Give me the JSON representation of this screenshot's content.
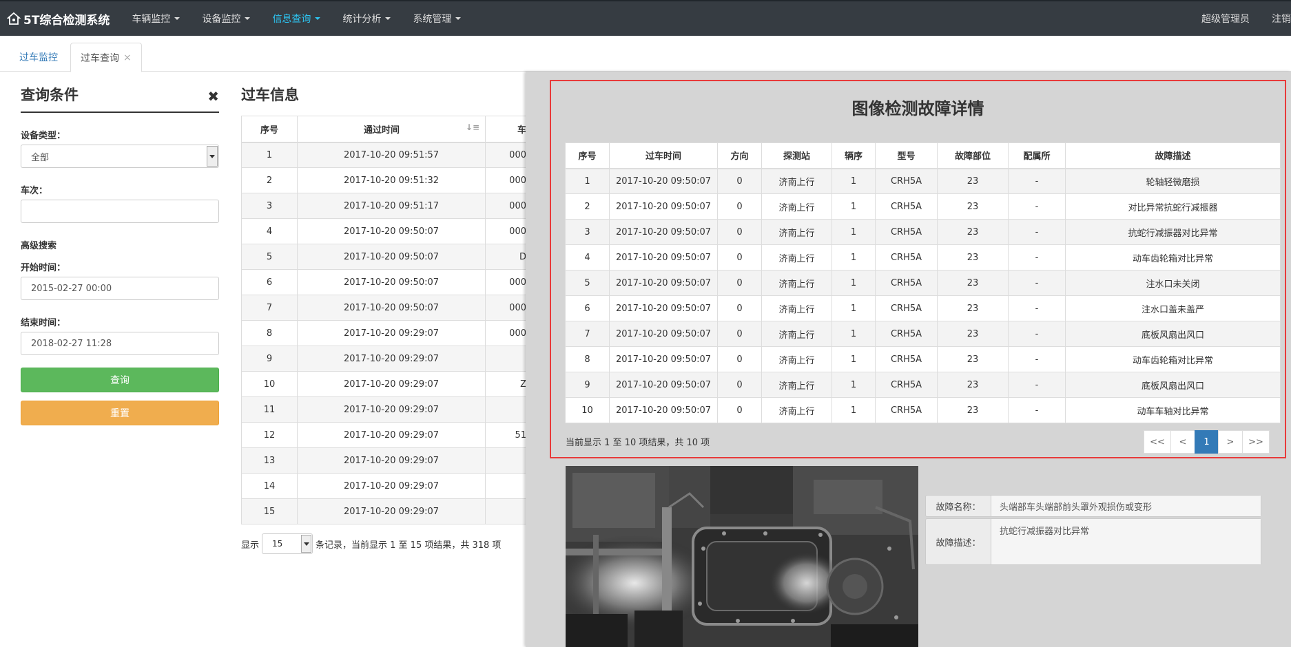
{
  "navbar": {
    "brand": "5T综合检测系统",
    "items": [
      "车辆监控",
      "设备监控",
      "信息查询",
      "统计分析",
      "系统管理"
    ],
    "active_index": 2,
    "user": "超级管理员",
    "logout": "注销",
    "colors": {
      "background": "#363c42",
      "active": "#2dc3f0"
    }
  },
  "tabs": [
    {
      "label": "过车监控"
    },
    {
      "label": "过车查询",
      "close": "×"
    }
  ],
  "query": {
    "title": "查询条件",
    "close": "✖",
    "device_type_label": "设备类型：",
    "device_type_value": "全部",
    "train_no_label": "车次：",
    "train_no_value": "",
    "advanced_label": "高级搜索",
    "start_label": "开始时间：",
    "start_value": "2015-02-27 00:00",
    "end_label": "结束时间：",
    "end_value": "2018-02-27 11:28",
    "search_button": "查询",
    "reset_button": "重置"
  },
  "passing": {
    "title": "过车信息",
    "headers": [
      "序号",
      "通过时间",
      "车"
    ],
    "rows": [
      [
        "1",
        "2017-10-20 09:51:57",
        "000"
      ],
      [
        "2",
        "2017-10-20 09:51:32",
        "000"
      ],
      [
        "3",
        "2017-10-20 09:51:17",
        "000"
      ],
      [
        "4",
        "2017-10-20 09:50:07",
        "000"
      ],
      [
        "5",
        "2017-10-20 09:50:07",
        "D"
      ],
      [
        "6",
        "2017-10-20 09:50:07",
        "000"
      ],
      [
        "7",
        "2017-10-20 09:50:07",
        "000"
      ],
      [
        "8",
        "2017-10-20 09:29:07",
        "000"
      ],
      [
        "9",
        "2017-10-20 09:29:07",
        ""
      ],
      [
        "10",
        "2017-10-20 09:29:07",
        "Z"
      ],
      [
        "11",
        "2017-10-20 09:29:07",
        ""
      ],
      [
        "12",
        "2017-10-20 09:29:07",
        "51"
      ],
      [
        "13",
        "2017-10-20 09:29:07",
        ""
      ],
      [
        "14",
        "2017-10-20 09:29:07",
        ""
      ],
      [
        "15",
        "2017-10-20 09:29:07",
        ""
      ]
    ],
    "footer_show": "显示",
    "page_size": "15",
    "footer_text": "条记录，当前显示 1 至 15 项结果，共 318 项"
  },
  "detail": {
    "title": "图像检测故障详情",
    "headers": [
      "序号",
      "过车时间",
      "方向",
      "探测站",
      "辆序",
      "型号",
      "故障部位",
      "配属所",
      "故障描述"
    ],
    "rows": [
      [
        "1",
        "2017-10-20 09:50:07",
        "0",
        "济南上行",
        "1",
        "CRH5A",
        "23",
        "-",
        "轮轴轻微磨损"
      ],
      [
        "2",
        "2017-10-20 09:50:07",
        "0",
        "济南上行",
        "1",
        "CRH5A",
        "23",
        "-",
        "对比异常抗蛇行减振器"
      ],
      [
        "3",
        "2017-10-20 09:50:07",
        "0",
        "济南上行",
        "1",
        "CRH5A",
        "23",
        "-",
        "抗蛇行减振器对比异常"
      ],
      [
        "4",
        "2017-10-20 09:50:07",
        "0",
        "济南上行",
        "1",
        "CRH5A",
        "23",
        "-",
        "动车齿轮箱对比异常"
      ],
      [
        "5",
        "2017-10-20 09:50:07",
        "0",
        "济南上行",
        "1",
        "CRH5A",
        "23",
        "-",
        "注水口未关闭"
      ],
      [
        "6",
        "2017-10-20 09:50:07",
        "0",
        "济南上行",
        "1",
        "CRH5A",
        "23",
        "-",
        "注水口盖未盖严"
      ],
      [
        "7",
        "2017-10-20 09:50:07",
        "0",
        "济南上行",
        "1",
        "CRH5A",
        "23",
        "-",
        "底板风扇出风口"
      ],
      [
        "8",
        "2017-10-20 09:50:07",
        "0",
        "济南上行",
        "1",
        "CRH5A",
        "23",
        "-",
        "动车齿轮箱对比异常"
      ],
      [
        "9",
        "2017-10-20 09:50:07",
        "0",
        "济南上行",
        "1",
        "CRH5A",
        "23",
        "-",
        "底板风扇出风口"
      ],
      [
        "10",
        "2017-10-20 09:50:07",
        "0",
        "济南上行",
        "1",
        "CRH5A",
        "23",
        "-",
        "动车车轴对比异常"
      ]
    ],
    "info": "当前显示 1 至 10 项结果，共 10 项",
    "pager": [
      "<<",
      "<",
      "1",
      ">",
      ">>"
    ],
    "pager_active": "1",
    "fault_name_label": "故障名称：",
    "fault_name_value": "头端部车头端部前头罩外观损伤或变形",
    "fault_desc_label": "故障描述：",
    "fault_desc_value": "抗蛇行减振器对比异常",
    "highlight_color": "#e83a3a"
  }
}
